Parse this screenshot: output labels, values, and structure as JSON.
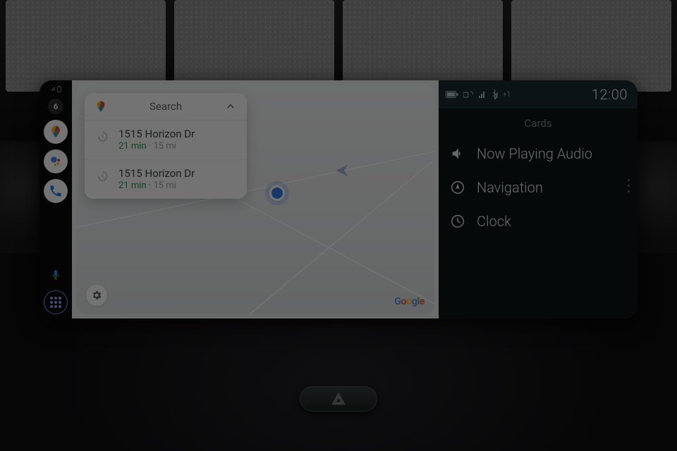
{
  "oem": {
    "time": "12:00",
    "cards_label": "Cards",
    "items": [
      {
        "label": "Now Playing Audio"
      },
      {
        "label": "Navigation"
      },
      {
        "label": "Clock"
      }
    ]
  },
  "aa": {
    "rail": {
      "notification_count": "6"
    },
    "maps": {
      "search_label": "Search",
      "logo": "Google",
      "suggestions": [
        {
          "title": "1515 Horizon Dr",
          "eta": "21 min",
          "distance": "15 mi"
        },
        {
          "title": "1515 Horizon Dr",
          "eta": "21 min",
          "distance": "15 mi"
        }
      ]
    }
  },
  "separator": " · "
}
